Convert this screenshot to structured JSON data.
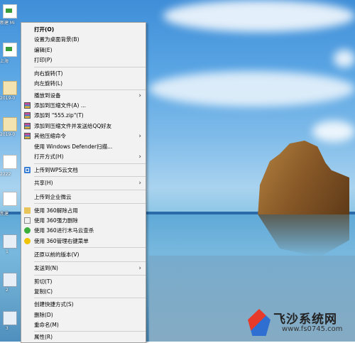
{
  "desktop": {
    "labels": [
      "新建 Mi",
      "上海",
      "2019-0",
      "2019-0",
      "2222",
      "新建",
      "1",
      "2",
      "3"
    ]
  },
  "menu": {
    "open": "打开(O)",
    "set_background": "设置为桌面背景(B)",
    "edit": "编辑(E)",
    "print": "打印(P)",
    "rotate_right": "向右旋转(T)",
    "rotate_left": "向左旋转(L)",
    "cast": "播放到设备",
    "add_archive": "添加到压缩文件(A) ...",
    "add_zip": "添加到 \"555.zip\"(T)",
    "add_qq": "添加到压缩文件并发送给QQ好友",
    "other_compress": "其他压缩命令",
    "defender": "使用 Windows Defender扫描...",
    "open_with": "打开方式(H)",
    "wps_upload": "上传到WPS云文档",
    "share": "共享(H)",
    "enterprise_cloud": "上传到企业微云",
    "unlock_360": "使用 360解除占用",
    "force_delete_360": "使用 360强力删除",
    "trojan_scan_360": "使用 360进行木马云查杀",
    "manage_menu_360": "使用 360管理右键菜单",
    "restore_version": "还原以前的版本(V)",
    "send_to": "发送到(N)",
    "cut": "剪切(T)",
    "copy": "复制(C)",
    "create_shortcut": "创建快捷方式(S)",
    "delete": "删除(D)",
    "rename": "重命名(M)",
    "properties": "属性(R)"
  },
  "watermark": {
    "title": "飞沙系统网",
    "url": "www.fs0745.com"
  }
}
